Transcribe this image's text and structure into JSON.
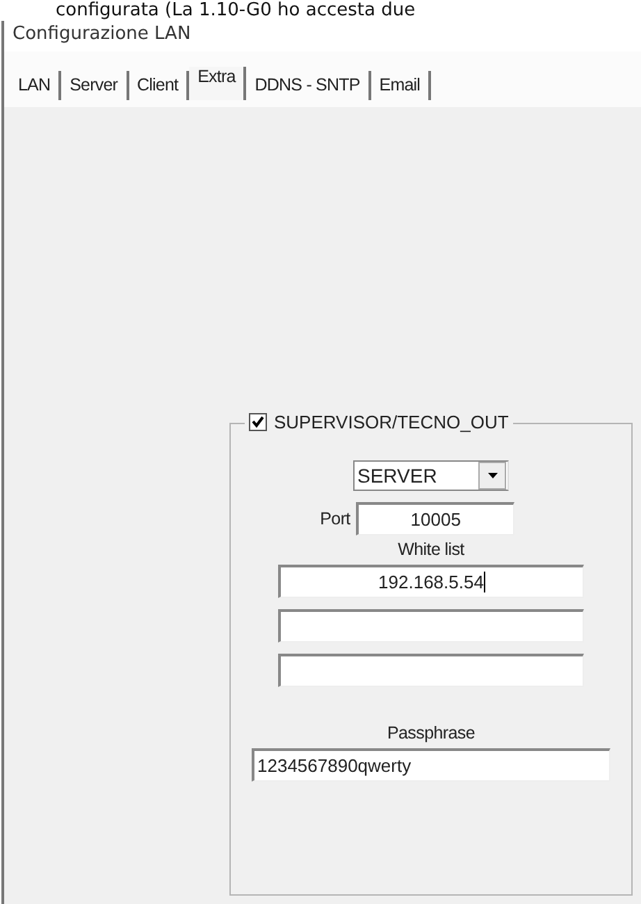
{
  "document_text": "configurata (La 1.10-G0 ho accesta due",
  "window": {
    "title": "Configurazione LAN"
  },
  "tabs": [
    {
      "label": "LAN",
      "selected": false
    },
    {
      "label": "Server",
      "selected": false
    },
    {
      "label": "Client",
      "selected": false
    },
    {
      "label": "Extra",
      "selected": true
    },
    {
      "label": "DDNS - SNTP",
      "selected": false
    },
    {
      "label": "Email",
      "selected": false
    }
  ],
  "group": {
    "label": "SUPERVISOR/TECNO_OUT",
    "checked": true,
    "mode": {
      "value": "SERVER"
    },
    "port": {
      "label": "Port",
      "value": "10005"
    },
    "white_list": {
      "label": "White list",
      "entries": [
        {
          "kind": "filled",
          "value": "192.168.5.54"
        },
        {
          "kind": "empty"
        },
        {
          "kind": "empty"
        }
      ]
    },
    "passphrase": {
      "label": "Passphrase",
      "value": "1234567890qwerty"
    }
  }
}
